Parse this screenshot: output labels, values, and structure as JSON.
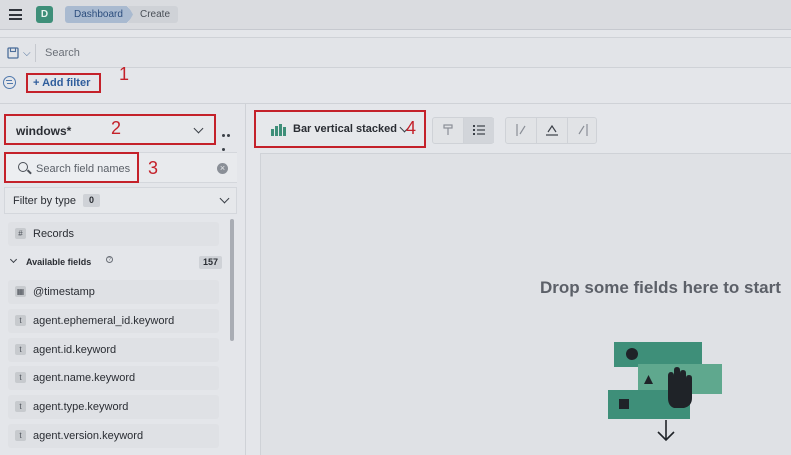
{
  "header": {
    "app_avatar": "D",
    "breadcrumbs": [
      "Dashboard",
      "Create"
    ]
  },
  "query_bar": {
    "search_placeholder": "Search"
  },
  "filter_bar": {
    "add_filter_label": "+ Add filter"
  },
  "annotations": [
    "1",
    "2",
    "3",
    "4"
  ],
  "sidebar": {
    "index_pattern": "windows*",
    "field_search_placeholder": "Search field names",
    "filter_by_type_label": "Filter by type",
    "filter_by_type_count": "0",
    "records_label": "Records",
    "available_fields_label": "Available fields",
    "available_fields_count": "157",
    "fields": [
      {
        "name": "@timestamp",
        "type": "date"
      },
      {
        "name": "agent.ephemeral_id.keyword",
        "type": "string"
      },
      {
        "name": "agent.id.keyword",
        "type": "string"
      },
      {
        "name": "agent.name.keyword",
        "type": "string"
      },
      {
        "name": "agent.type.keyword",
        "type": "string"
      },
      {
        "name": "agent.version.keyword",
        "type": "string"
      }
    ]
  },
  "workspace": {
    "chart_type_label": "Bar vertical stacked",
    "empty_message": "Drop some fields here to start"
  },
  "colors": {
    "annotation_red": "#c4212a",
    "accent_green": "#3e8f79",
    "link_blue": "#2f5d9c"
  }
}
